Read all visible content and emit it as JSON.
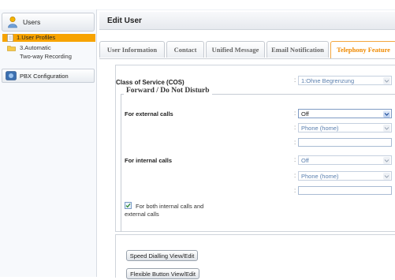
{
  "sidebar": {
    "users_label": "Users",
    "items": [
      {
        "label": "1.User Profiles"
      },
      {
        "label_line1": "3.Automatic",
        "label_line2": "Two-way Recording"
      }
    ],
    "pbx_label": "PBX Configuration"
  },
  "main": {
    "title": "Edit User",
    "tabs": [
      {
        "label": "User Information"
      },
      {
        "label": "Contact"
      },
      {
        "label": "Unified Message"
      },
      {
        "label": "Email Notification"
      },
      {
        "label": "Telephony Feature"
      }
    ]
  },
  "form": {
    "cos_label": "Class of Service (COS)",
    "cos_value": "1:Ohne Begrenzung",
    "legend": "Forward / Do Not Disturb",
    "external_label": "For external calls",
    "external_mode": "Off",
    "external_dest": "Phone (home)",
    "internal_label": "For internal calls",
    "internal_mode": "Off",
    "internal_dest": "Phone (home)",
    "both_label_line1": "For both internal calls and",
    "both_label_line2": "external calls",
    "both_checked": true,
    "colon": ":"
  },
  "buttons": {
    "speed_dial": "Speed Dialling View/Edit",
    "flexible": "Flexible Button View/Edit"
  },
  "colors": {
    "accent": "#f7a300",
    "active_tab_text": "#f08a00"
  }
}
